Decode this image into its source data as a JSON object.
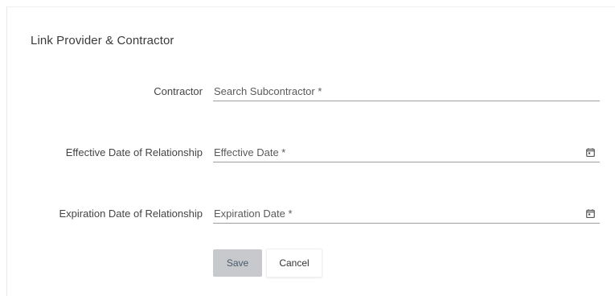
{
  "form": {
    "title": "Link Provider & Contractor",
    "contractor": {
      "label": "Contractor",
      "placeholder": "Search Subcontractor *"
    },
    "effective_date": {
      "label": "Effective Date of Relationship",
      "placeholder": "Effective Date *",
      "icon": "calendar-icon"
    },
    "expiration_date": {
      "label": "Expiration Date of Relationship",
      "placeholder": "Expiration Date *",
      "icon": "calendar-icon"
    },
    "actions": {
      "save_label": "Save",
      "cancel_label": "Cancel"
    }
  },
  "colors": {
    "save_button_bg": "#c7c9cc",
    "field_underline": "#9e9e9e"
  }
}
